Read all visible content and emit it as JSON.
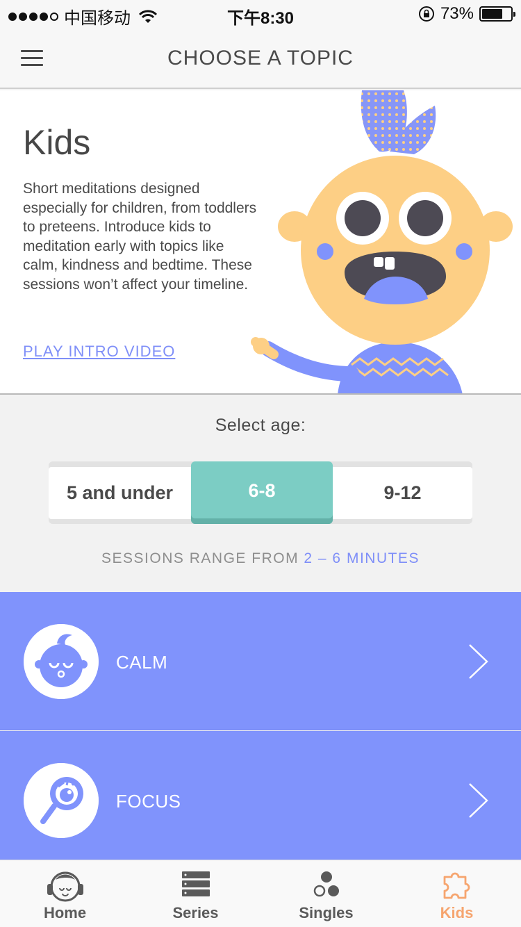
{
  "status_bar": {
    "carrier": "中国移动",
    "time": "下午8:30",
    "battery_percent": "73%",
    "battery_level": 0.73
  },
  "nav": {
    "menu_icon": "hamburger-menu-icon",
    "title": "CHOOSE A TOPIC"
  },
  "hero": {
    "title": "Kids",
    "description": "Short meditations designed especially for children, from toddlers to preteens. Introduce kids to meditation early with topics like calm, kindness and bedtime. These sessions won’t affect your timeline.",
    "link": "PLAY INTRO VIDEO"
  },
  "age": {
    "label": "Select age:",
    "options": [
      "5 and under",
      "6-8",
      "9-12"
    ],
    "selected": "6-8",
    "range_prefix": "SESSIONS RANGE FROM ",
    "range_value": "2 – 6 MINUTES"
  },
  "topics": [
    {
      "label": "CALM",
      "icon": "calm-face-icon"
    },
    {
      "label": "FOCUS",
      "icon": "magnifier-eye-icon"
    }
  ],
  "tabs": [
    {
      "label": "Home",
      "icon": "home-face-icon"
    },
    {
      "label": "Series",
      "icon": "series-stack-icon"
    },
    {
      "label": "Singles",
      "icon": "singles-dots-icon"
    },
    {
      "label": "Kids",
      "icon": "puzzle-icon",
      "active": true
    }
  ],
  "colors": {
    "accent_blue": "#8093fc",
    "teal": "#7ccdc4",
    "orange_active": "#f6a56f",
    "kid_face": "#fdcf85"
  }
}
